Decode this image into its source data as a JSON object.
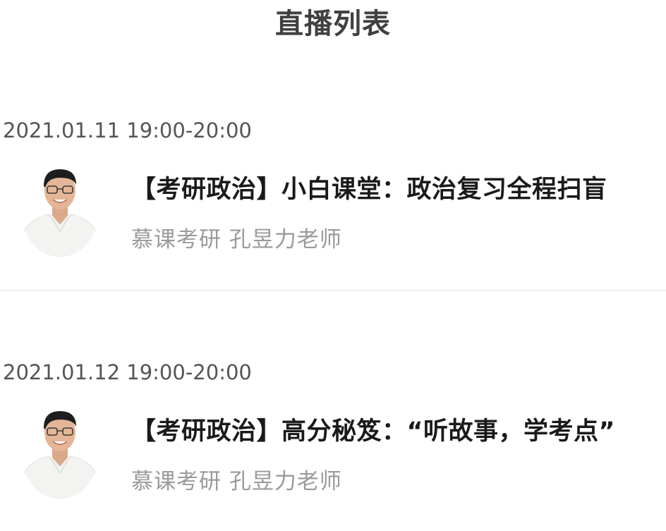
{
  "header": {
    "title": "直播列表"
  },
  "live_list": [
    {
      "time": "2021.01.11 19:00-20:00",
      "title": "【考研政治】小白课堂：政治复习全程扫盲",
      "teacher": "慕课考研 孔昱力老师",
      "avatar_icon": "teacher-avatar"
    },
    {
      "time": "2021.01.12 19:00-20:00",
      "title": "【考研政治】高分秘笈：“听故事，学考点”",
      "teacher": "慕课考研 孔昱力老师",
      "avatar_icon": "teacher-avatar"
    }
  ],
  "colors": {
    "title": "#404040",
    "time": "#555555",
    "item_title": "#1a1a1a",
    "teacher": "#9a9a9a",
    "divider": "#ededed"
  }
}
